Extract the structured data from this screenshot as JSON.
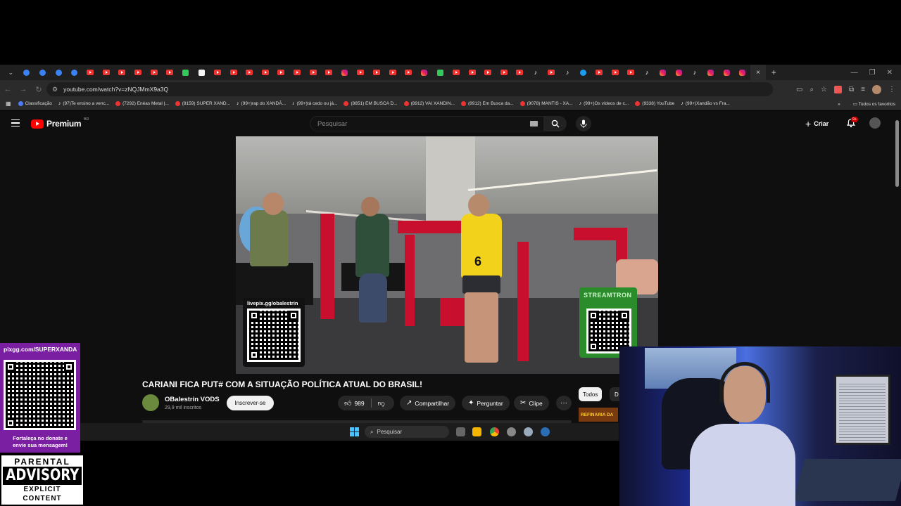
{
  "browser": {
    "tab_icons": [
      "ext",
      "g",
      "ext",
      "ext",
      "yt",
      "yt",
      "yt",
      "yt",
      "yt",
      "yt",
      "gr",
      "wh",
      "yt",
      "yt",
      "yt",
      "yt",
      "yt",
      "yt",
      "yt",
      "yt",
      "ig",
      "yt",
      "yt",
      "yt",
      "yt",
      "ig",
      "gr",
      "yt",
      "yt",
      "yt",
      "yt",
      "yt",
      "tk",
      "yt",
      "tk",
      "bl",
      "yt",
      "yt",
      "yt",
      "tk",
      "ig",
      "ig",
      "tk",
      "ig",
      "ig",
      "ig"
    ],
    "active_tab_close": "×",
    "new_tab": "+",
    "url": "youtube.com/watch?v=zNQJMmX9a3Q",
    "bookmarks": [
      {
        "icon": "blue",
        "label": "Classificação"
      },
      {
        "icon": "tk",
        "label": "(97)Te ensino a venc..."
      },
      {
        "icon": "yt",
        "label": "(7292) Enéas Metal |..."
      },
      {
        "icon": "yt",
        "label": "(8159) SUPER XAND..."
      },
      {
        "icon": "tk",
        "label": "(99+)rap do XANDÃ..."
      },
      {
        "icon": "tk",
        "label": "(99+)tá cedo ou já..."
      },
      {
        "icon": "yt",
        "label": "(8851) EM BUSCA D..."
      },
      {
        "icon": "yt",
        "label": "(8912) VAI XANDIN..."
      },
      {
        "icon": "yt",
        "label": "(8912) Em Busca da..."
      },
      {
        "icon": "yt",
        "label": "(9078) MANTIS - XA..."
      },
      {
        "icon": "tk",
        "label": "(99+)Os vídeos de c..."
      },
      {
        "icon": "yt",
        "label": "(9338) YouTube"
      },
      {
        "icon": "tk",
        "label": "(99+)Xandão vs Fra..."
      }
    ],
    "bookmarks_more": "»",
    "all_favorites": "Todos os favoritos"
  },
  "youtube": {
    "logo_text": "Premium",
    "logo_country": "BR",
    "search_placeholder": "Pesquisar",
    "create_label": "Criar",
    "notif_badge": "9+",
    "video_title": "CARIANI FICA PUT# COM A SITUAÇÃO POLÍTICA ATUAL DO BRASIL!",
    "channel_name": "OBalestrin VODS",
    "channel_subs": "29,9 mil inscritos",
    "subscribe_label": "Inscrever-se",
    "like_count": "989",
    "share_label": "Compartilhar",
    "ask_label": "Perguntar",
    "clip_label": "Clipe",
    "more_label": "···",
    "chip_all": "Todos",
    "chip_next": "D",
    "rec_thumb_text": "REFINARIA DA",
    "video_overlay_livepix": "livepix.gg/obalestrin",
    "video_overlay_sponsor": "STREAMTRON"
  },
  "taskbar": {
    "search_label": "Pesquisar"
  },
  "stream_overlay": {
    "pix_url": "pixgg.com/SUPERXANDA",
    "pix_message_line1": "Fortaleça no donate e",
    "pix_message_line2": "envie sua mensagem!",
    "advisory_top": "PARENTAL",
    "advisory_mid": "ADVISORY",
    "advisory_bottom": "EXPLICIT CONTENT"
  },
  "colors": {
    "youtube_red": "#ff0000",
    "pix_purple": "#7b1fa2",
    "yt_bg": "#0f0f0f",
    "machine_red": "#c8102e"
  }
}
